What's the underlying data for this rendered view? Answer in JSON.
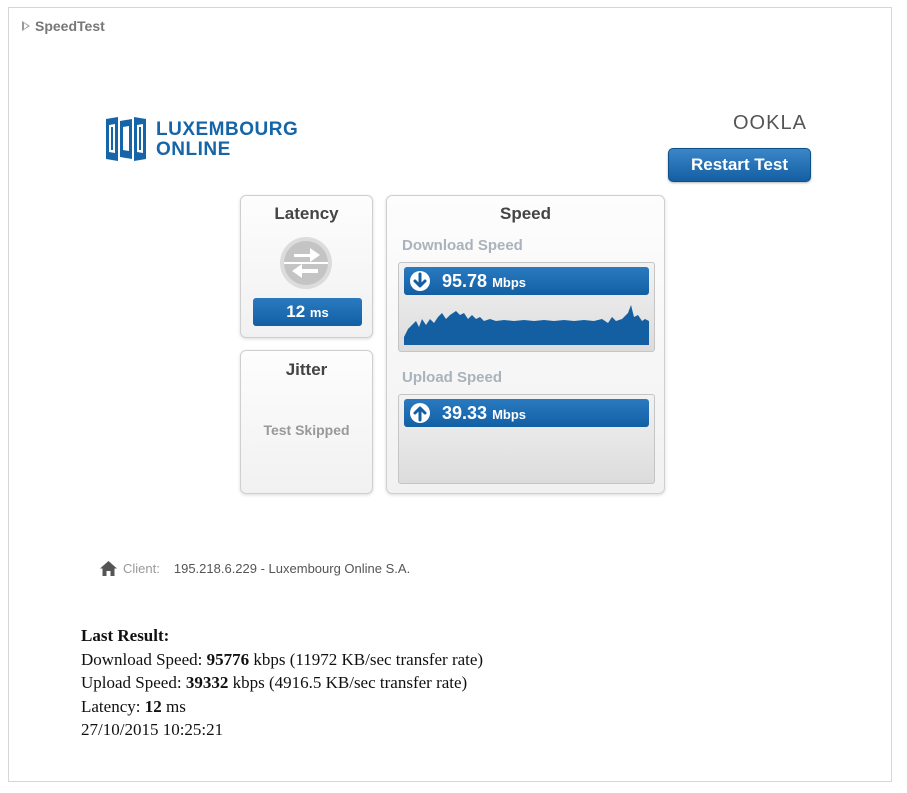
{
  "header": {
    "title": "SpeedTest"
  },
  "provider": {
    "line1": "LUXEMBOURG",
    "line2": "ONLINE",
    "brand_color": "#1565a8"
  },
  "ookla": {
    "label": "OOKLA"
  },
  "restart_button": {
    "label": "Restart Test"
  },
  "latency_panel": {
    "title": "Latency",
    "value": "12",
    "unit": "ms"
  },
  "jitter_panel": {
    "title": "Jitter",
    "status": "Test Skipped"
  },
  "speed_panel": {
    "title": "Speed",
    "download": {
      "label": "Download Speed",
      "value": "95.78",
      "unit": "Mbps"
    },
    "upload": {
      "label": "Upload Speed",
      "value": "39.33",
      "unit": "Mbps"
    }
  },
  "client": {
    "label": "Client:",
    "value": "195.218.6.229 - Luxembourg Online S.A."
  },
  "last_result": {
    "heading": "Last Result:",
    "download_prefix": "Download Speed: ",
    "download_value": "95776",
    "download_suffix": " kbps (11972 KB/sec transfer rate)",
    "upload_prefix": "Upload Speed: ",
    "upload_value": "39332",
    "upload_suffix": " kbps (4916.5 KB/sec transfer rate)",
    "latency_prefix": "Latency: ",
    "latency_value": "12",
    "latency_suffix": " ms",
    "timestamp": "27/10/2015 10:25:21"
  },
  "colors": {
    "accent": "#1565a8",
    "pill": "#135fa2"
  }
}
